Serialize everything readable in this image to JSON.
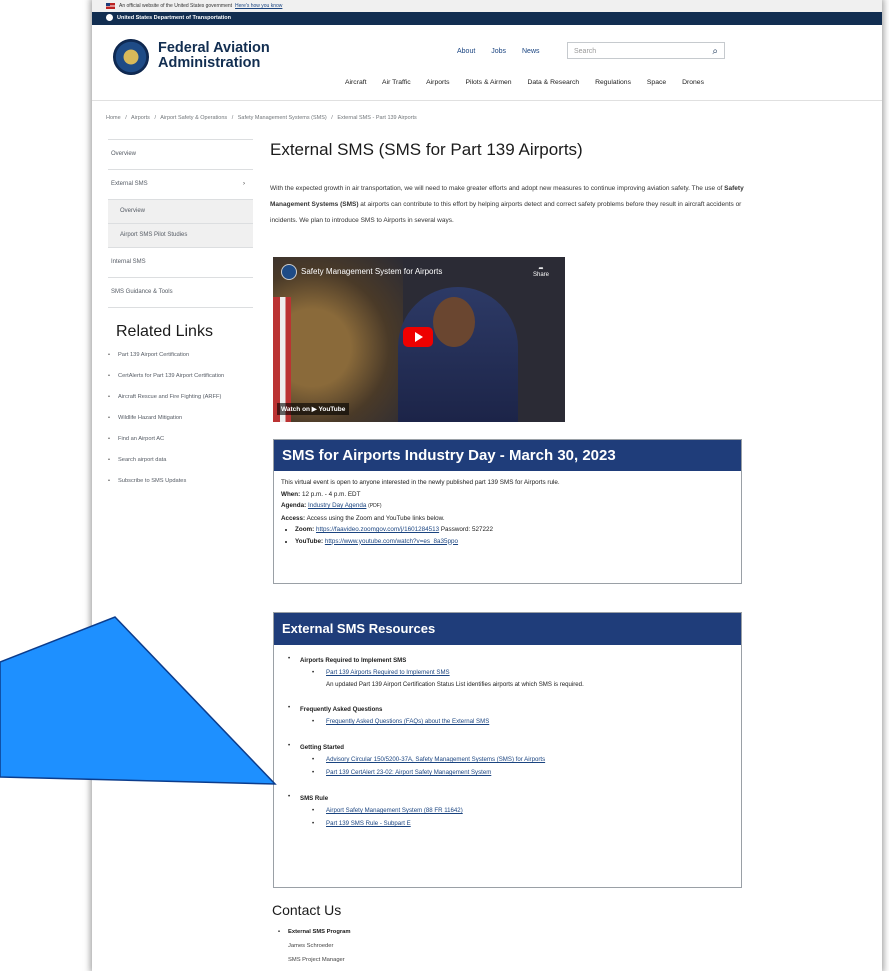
{
  "banner": {
    "text": "An official website of the United States government",
    "howto": "Here's how you know"
  },
  "dot_bar": {
    "text": "United States Department of Transportation"
  },
  "header": {
    "org_line1": "Federal Aviation",
    "org_line2": "Administration",
    "util_links": [
      "About",
      "Jobs",
      "News"
    ],
    "search_placeholder": "Search",
    "nav": [
      "Aircraft",
      "Air Traffic",
      "Airports",
      "Pilots & Airmen",
      "Data & Research",
      "Regulations",
      "Space",
      "Drones"
    ]
  },
  "breadcrumb": [
    "Home",
    "/",
    "Airports",
    "/",
    "Airport Safety & Operations",
    "/",
    "Safety Management Systems (SMS)",
    "/",
    "External SMS - Part 139 Airports"
  ],
  "sidenav": {
    "items": [
      {
        "label": "Overview"
      },
      {
        "label": "External SMS",
        "chevron": "›"
      },
      {
        "label": "Overview"
      },
      {
        "label": "Airport SMS Pilot Studies"
      },
      {
        "label": "Internal SMS"
      },
      {
        "label": "SMS Guidance & Tools"
      }
    ]
  },
  "related": {
    "title": "Related Links",
    "links": [
      "Part 139 Airport Certification",
      "CertAlerts for Part 139 Airport Certification",
      "Aircraft Rescue and Fire Fighting (ARFF)",
      "Wildlife Hazard Mitigation",
      "Find an Airport AC",
      "Search airport data",
      "Subscribe to SMS Updates"
    ]
  },
  "main": {
    "title": "External SMS (SMS for Part 139 Airports)",
    "intro_a": "With the expected growth in air transportation, we will need to make greater efforts and adopt new measures to continue improving aviation safety. The use of ",
    "intro_bold": "Safety Management Systems (SMS)",
    "intro_b": " at airports can contribute to this effort by helping airports detect and correct safety problems before they result in aircraft accidents or incidents. We plan to introduce SMS to Airports in several ways."
  },
  "video": {
    "title": "Safety Management System for Airports",
    "share": "Share",
    "watch": "Watch on ▶ YouTube"
  },
  "industry_day": {
    "heading": "SMS for Airports Industry Day - March 30, 2023",
    "desc": "This virtual event is open to anyone interested in the newly published part 139 SMS for Airports rule.",
    "when_label": "When:",
    "when": "12 p.m. - 4 p.m. EDT",
    "agenda_label": "Agenda:",
    "agenda_link": "Industry Day Agenda",
    "agenda_suffix": "(PDF)",
    "access_label": "Access:",
    "access": "Access using the Zoom and YouTube links below.",
    "zoom_label": "Zoom:",
    "zoom_link": "https://faavideo.zoomgov.com/j/1601284513",
    "zoom_pw": "Password: 527222",
    "yt_label": "YouTube:",
    "yt_link": "https://www.youtube.com/watch?v=es_8a35ppo"
  },
  "resources": {
    "heading": "External SMS Resources",
    "sections": [
      {
        "title": "Airports Required to Implement SMS",
        "links": [
          "Part 139 Airports Required to Implement SMS"
        ],
        "note": "An updated Part 139 Airport Certification Status List identifies airports at which SMS is required."
      },
      {
        "title": "Frequently Asked Questions",
        "links": [
          "Frequently Asked Questions (FAQs) about the External SMS"
        ]
      },
      {
        "title": "Getting Started",
        "links": [
          "Advisory Circular 150/5200-37A, Safety Management Systems (SMS) for Airports",
          "Part 139 CertAlert 23-02: Airport Safety Management System"
        ]
      },
      {
        "title": "SMS Rule",
        "links": [
          "Airport Safety Management System (88 FR 11642)",
          "Part 139 SMS Rule - Subpart E"
        ]
      }
    ]
  },
  "contact": {
    "title": "Contact Us",
    "program": "External SMS Program",
    "name": "James Schroeder",
    "role": "SMS Project Manager"
  },
  "colors": {
    "navy": "#122e51",
    "box_head": "#1f3d7a",
    "callout": "#1e90ff",
    "link": "#1a4480"
  }
}
